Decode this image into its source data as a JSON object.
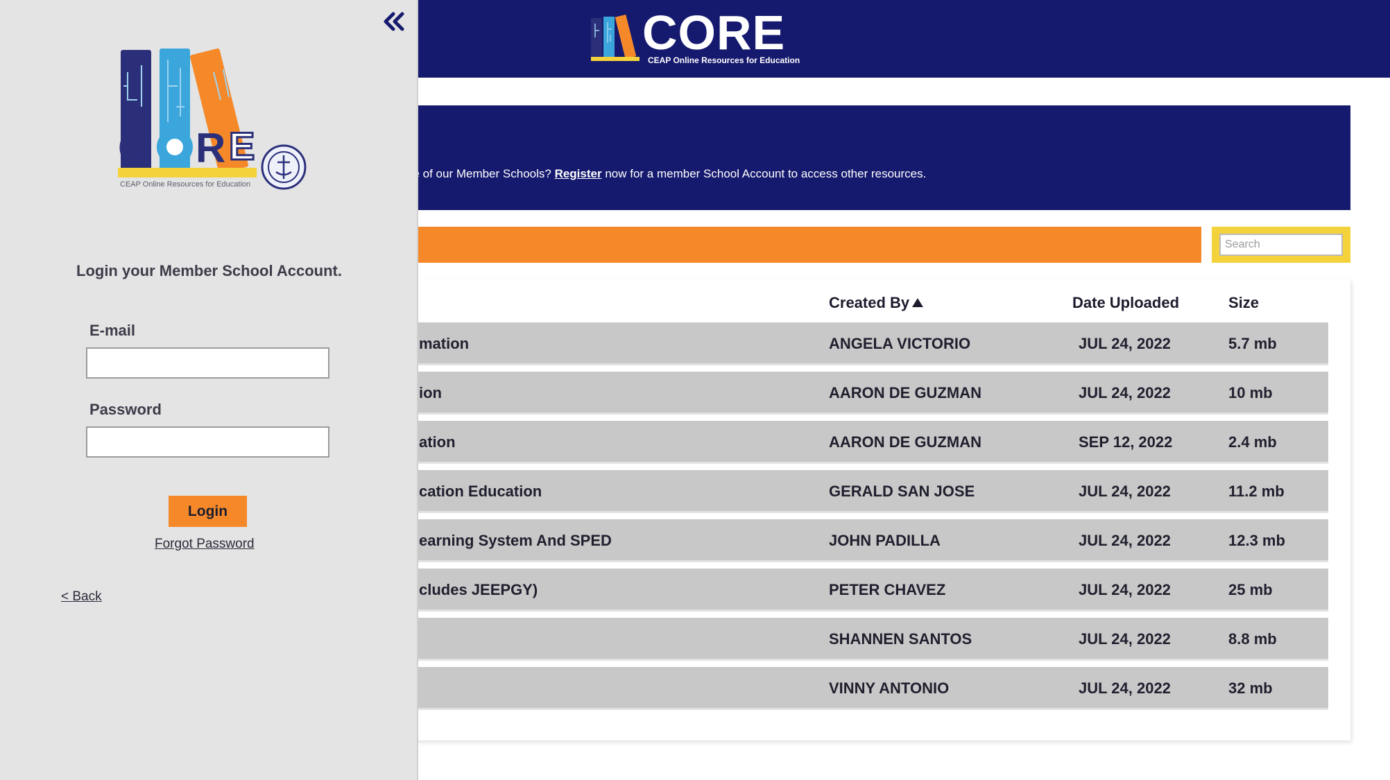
{
  "header": {
    "logo_text": "CORE",
    "logo_tagline": "CEAP Online Resources for Education"
  },
  "banner": {
    "text_before": "ne of our Member Schools? ",
    "register_link": "Register",
    "text_after": " now for a member School Account to access other resources."
  },
  "search": {
    "placeholder": "Search"
  },
  "table": {
    "headers": {
      "created_by": "Created By",
      "date_uploaded": "Date Uploaded",
      "size": "Size"
    },
    "rows": [
      {
        "title": "mation",
        "created_by": "ANGELA VICTORIO",
        "date": "JUL 24, 2022",
        "size": "5.7 mb"
      },
      {
        "title": "ion",
        "created_by": "AARON DE GUZMAN",
        "date": "JUL 24, 2022",
        "size": "10 mb"
      },
      {
        "title": "ation",
        "created_by": "AARON DE GUZMAN",
        "date": "SEP 12, 2022",
        "size": "2.4 mb"
      },
      {
        "title": "cation Education",
        "created_by": "GERALD SAN JOSE",
        "date": "JUL 24, 2022",
        "size": "11.2 mb"
      },
      {
        "title": "earning System And SPED",
        "created_by": "JOHN PADILLA",
        "date": "JUL 24, 2022",
        "size": "12.3 mb"
      },
      {
        "title": "cludes JEEPGY)",
        "created_by": "PETER CHAVEZ",
        "date": "JUL 24, 2022",
        "size": "25 mb"
      },
      {
        "title": "",
        "created_by": "SHANNEN SANTOS",
        "date": "JUL 24, 2022",
        "size": "8.8 mb"
      },
      {
        "title": "",
        "created_by": "VINNY ANTONIO",
        "date": "JUL 24, 2022",
        "size": "32 mb"
      }
    ]
  },
  "sidebar": {
    "logo_text": "CORE",
    "logo_tagline": "CEAP Online Resources for Education",
    "heading": "Login your Member School Account.",
    "email_label": "E-mail",
    "email_value": "",
    "password_label": "Password",
    "password_value": "",
    "login_button": "Login",
    "forgot_password": "Forgot Password",
    "back_link": "< Back"
  },
  "colors": {
    "navy": "#161a6e",
    "orange": "#f5892a",
    "yellow": "#f4d23b",
    "light_blue": "#3aa6dc",
    "row_gray": "#c8c8c8",
    "sidebar_bg": "#e4e4e4"
  },
  "icons": {
    "collapse": "double-chevron-left-icon",
    "sort": "triangle-up-icon",
    "seal": "ceap-seal-icon"
  }
}
